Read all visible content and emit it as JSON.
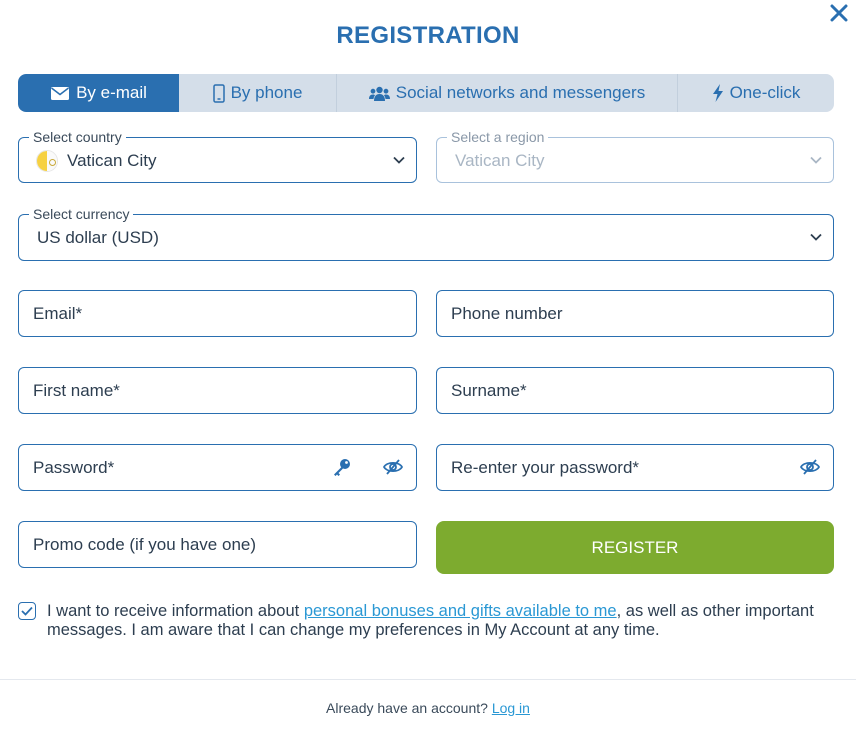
{
  "modal": {
    "title": "REGISTRATION"
  },
  "tabs": [
    {
      "label": "By e-mail",
      "icon": "envelope-icon",
      "active": true
    },
    {
      "label": "By phone",
      "icon": "phone-icon",
      "active": false
    },
    {
      "label": "Social networks and messengers",
      "icon": "users-icon",
      "active": false
    },
    {
      "label": "One-click",
      "icon": "lightning-icon",
      "active": false
    }
  ],
  "form": {
    "country": {
      "legend": "Select country",
      "value": "Vatican City",
      "flag": "vatican-flag-icon"
    },
    "region": {
      "legend": "Select a region",
      "value": "Vatican City",
      "disabled": true
    },
    "currency": {
      "legend": "Select currency",
      "value": "US dollar (USD)"
    },
    "email": {
      "placeholder": "Email*"
    },
    "phone": {
      "placeholder": "Phone number"
    },
    "first_name": {
      "placeholder": "First name*"
    },
    "surname": {
      "placeholder": "Surname*"
    },
    "password": {
      "placeholder": "Password*"
    },
    "password_repeat": {
      "placeholder": "Re-enter your password*"
    },
    "promo": {
      "placeholder": "Promo code (if you have one)"
    },
    "register_label": "REGISTER"
  },
  "consent": {
    "checked": true,
    "text_before": "I want to receive information about ",
    "link_text": "personal bonuses and gifts available to me",
    "text_after": ", as well as other important messages. I am aware that I can change my preferences in My Account at any time."
  },
  "footer": {
    "prompt": "Already have an account?",
    "login_label": "Log in"
  },
  "colors": {
    "primary": "#2a6fb0",
    "tab_bg": "#d4dee9",
    "register": "#7dab2f",
    "link": "#2a98d4"
  }
}
